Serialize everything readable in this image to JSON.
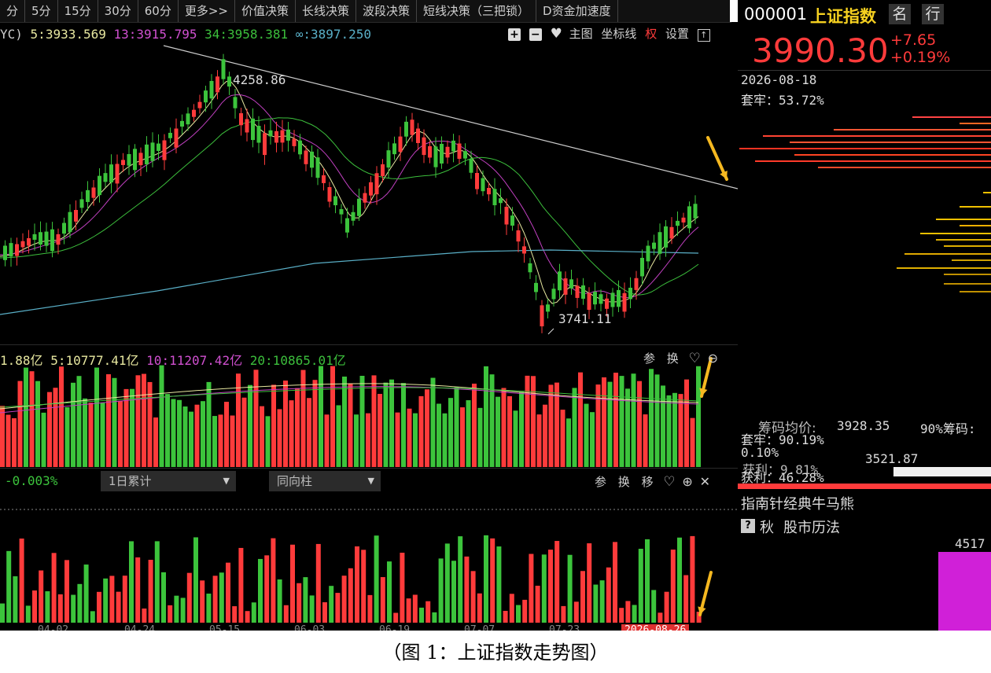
{
  "tabs": [
    "分",
    "5分",
    "15分",
    "30分",
    "60分",
    "更多>>",
    "价值决策",
    "长线决策",
    "波段决策",
    "短线决策（三把锁）",
    "D资金加速度"
  ],
  "ma_bar": {
    "prefix": "YC)",
    "ma5": "5:3933.569",
    "ma13": "13:3915.795",
    "ma34": "34:3958.381",
    "inf": "∞:3897.250"
  },
  "price_tools": {
    "main": "主图",
    "axis": "坐标线",
    "rights": "权",
    "settings": "设置"
  },
  "annotations": {
    "high": "4258.86",
    "low": "3741.11"
  },
  "volume_bar": {
    "prefix": "1.88亿",
    "v5": "5:10777.41亿",
    "v10": "10:11207.42亿",
    "v20": "20:10865.01亿",
    "t1": "参",
    "t2": "换"
  },
  "indicator_bar": {
    "value": "-0.003%",
    "select1": "1日累计",
    "select2": "同向柱",
    "t1": "参",
    "t2": "换",
    "t3": "移"
  },
  "dates": [
    "04-02",
    "04-24",
    "05-15",
    "06-03",
    "06-19",
    "07-07",
    "07-23",
    "2026-08-26"
  ],
  "side": {
    "code": "000001",
    "name": "上证指数",
    "btn1": "名",
    "btn2": "行",
    "price": "3990.30",
    "change": "+7.65",
    "change_pct": "+0.19%",
    "date": "2026-08-18",
    "trapped_top": "套牢：53.72%",
    "chip_avg_label": "筹码均价:",
    "chip_avg": "3928.35",
    "chip90": "90%筹码:",
    "trapped2": "套牢：90.19%",
    "pct_a": "0.10%",
    "profit1": "获利：9.81%",
    "price2": "3521.87",
    "profit2": "获利：46.28%",
    "guide": "指南针经典牛马熊",
    "icon_q": "?",
    "autumn": "秋",
    "calendar": "股市历法",
    "num": "4517"
  },
  "caption": "（图 1：上证指数走势图）",
  "colors": {
    "up": "#ff3b3b",
    "down": "#3cc43c",
    "ma5": "#e8e8a0",
    "ma13": "#c040c0",
    "ma34": "#3cbf3c",
    "ma_inf": "#5ab0c8",
    "arrow": "#f5b820",
    "price": "#ff3b3b"
  }
}
